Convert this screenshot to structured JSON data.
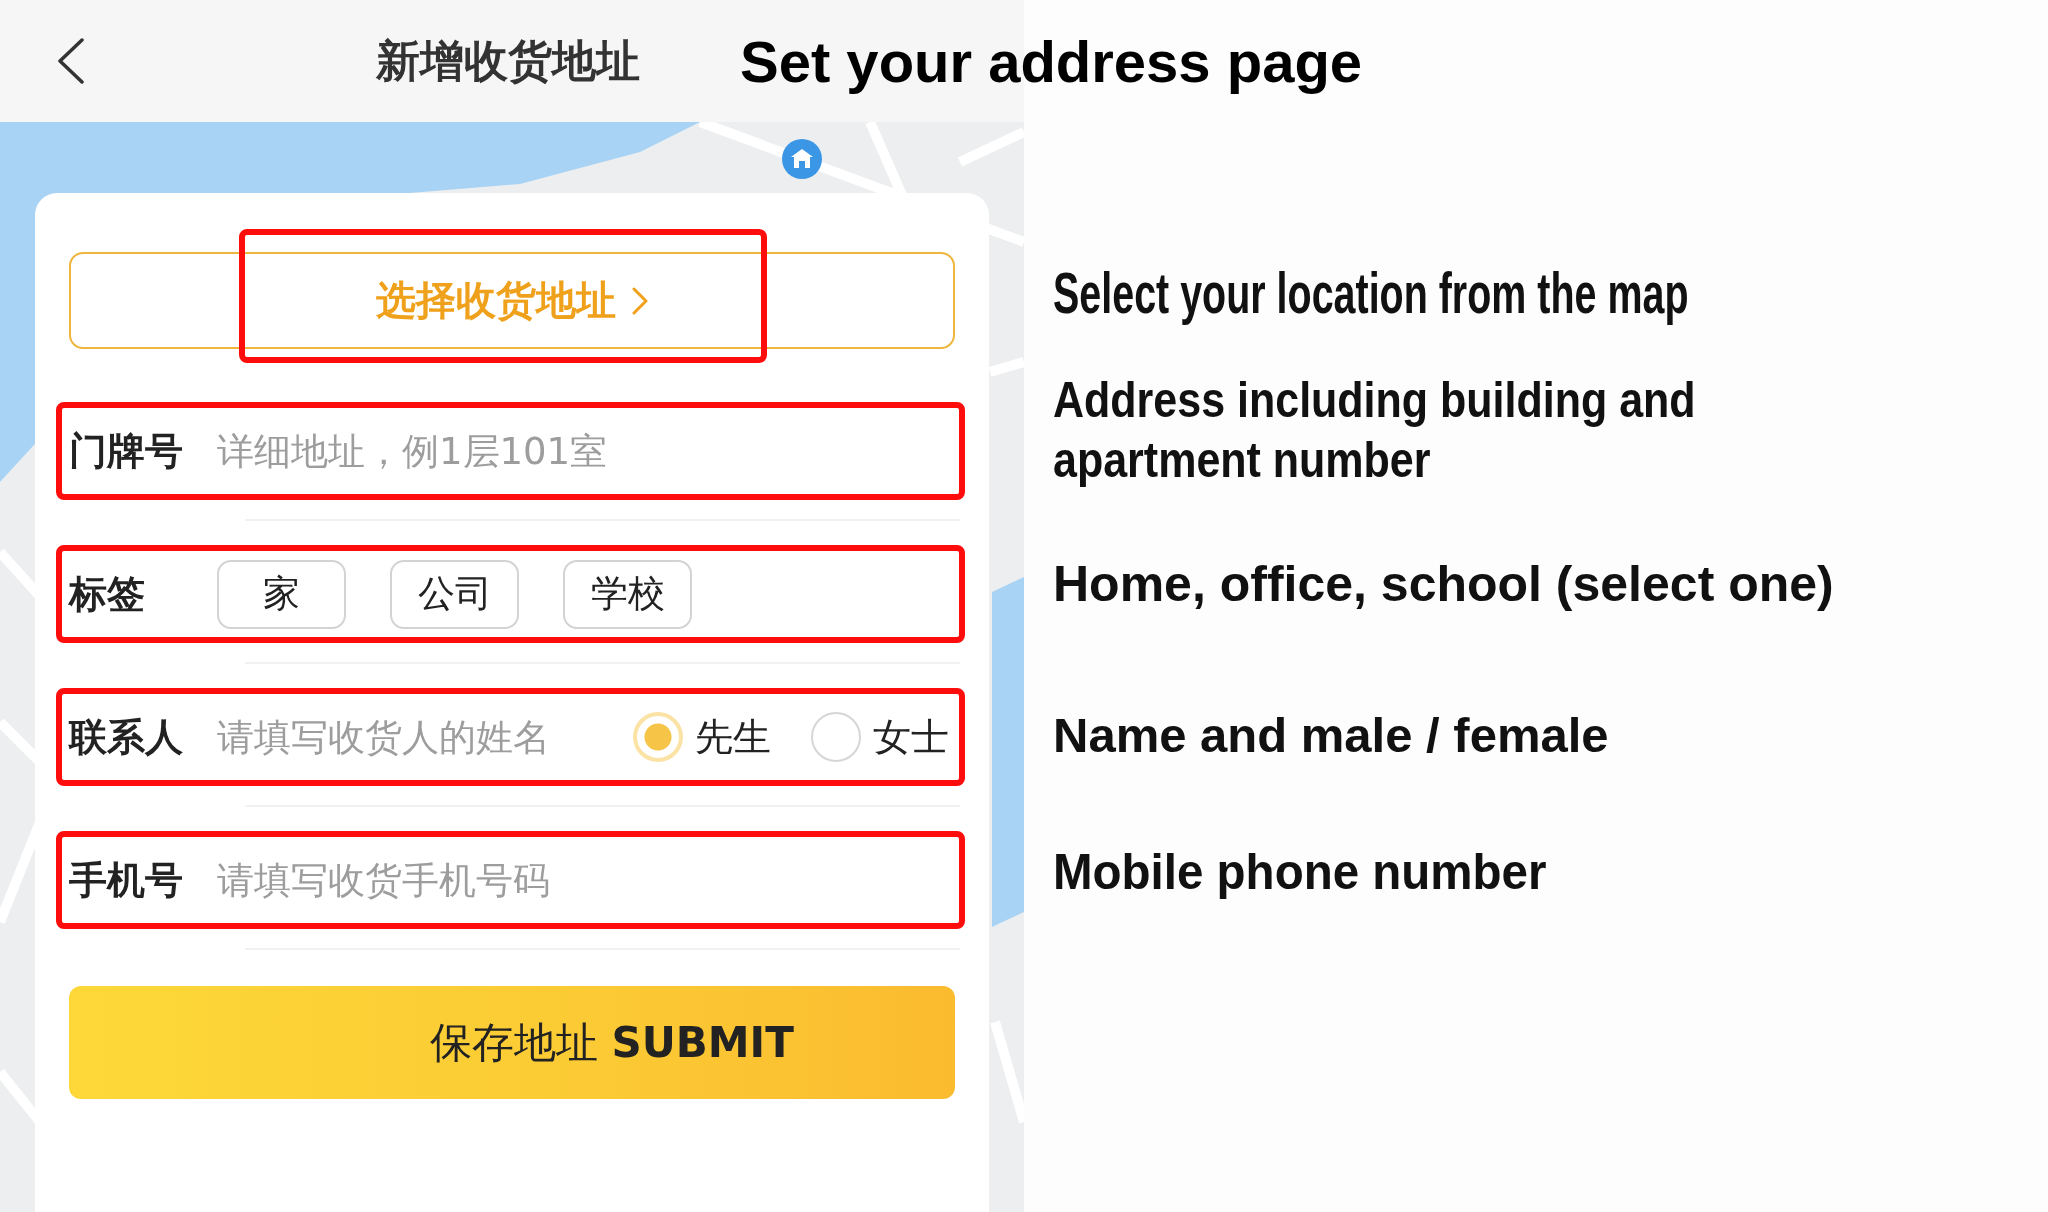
{
  "header": {
    "title": "新增收货地址",
    "caption": "Set your address page"
  },
  "form": {
    "select_address": {
      "label": "选择收货地址",
      "highlighted": true
    },
    "fields": [
      {
        "kind": "text",
        "label": "门牌号",
        "placeholder": "详细地址，例1层101室",
        "highlighted": true
      },
      {
        "kind": "tags",
        "label": "标签",
        "options": [
          {
            "label": "家",
            "selected": false
          },
          {
            "label": "公司",
            "selected": false
          },
          {
            "label": "学校",
            "selected": false
          }
        ],
        "highlighted": true
      },
      {
        "kind": "contact",
        "label": "联系人",
        "placeholder": "请填写收货人的姓名",
        "options": [
          {
            "label": "先生",
            "selected": true
          },
          {
            "label": "女士",
            "selected": false
          }
        ],
        "highlighted": true
      },
      {
        "kind": "text",
        "label": "手机号",
        "placeholder": "请填写收货手机号码",
        "highlighted": true
      }
    ],
    "submit": {
      "label": "保存地址 **SUBMIT**"
    }
  },
  "notes": [
    "Select your location from the map",
    "Address including building and apartment number",
    "Home, office, school (select one)",
    "Name and male / female",
    "Mobile phone number"
  ]
}
